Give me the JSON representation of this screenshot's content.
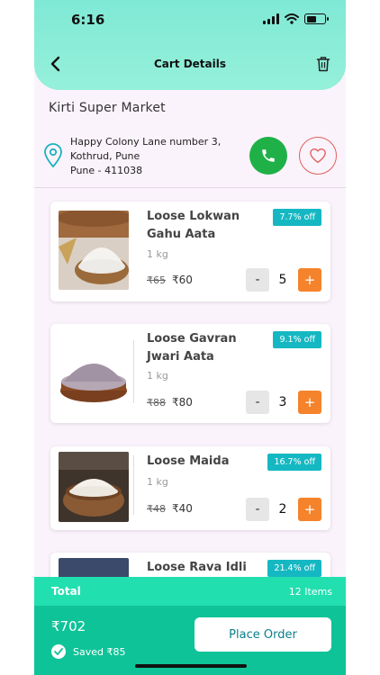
{
  "status_bar": {
    "time": "6:16"
  },
  "header": {
    "title": "Cart Details"
  },
  "store": {
    "name": "Kirti Super Market",
    "address_lines": [
      "Happy Colony Lane number 3,",
      "Kothrud, Pune",
      "Pune - 411038"
    ]
  },
  "cart": {
    "items": [
      {
        "name": "Loose Lokwan Gahu Aata",
        "discount": "7.7% off",
        "weight": "1 kg",
        "old_price": "₹65",
        "price": "₹60",
        "qty": "5"
      },
      {
        "name": "Loose Gavran Jwari Aata",
        "discount": "9.1% off",
        "weight": "1 kg",
        "old_price": "₹88",
        "price": "₹80",
        "qty": "3"
      },
      {
        "name": "Loose Maida",
        "discount": "16.7% off",
        "weight": "1 kg",
        "old_price": "₹48",
        "price": "₹40",
        "qty": "2"
      },
      {
        "name": "Loose Rava Idli",
        "discount": "21.4% off"
      }
    ],
    "minus_label": "-",
    "plus_label": "+"
  },
  "footer": {
    "total_label": "Total",
    "items_count": "12  Items",
    "grand_total": "₹702",
    "saved": "Saved ₹85",
    "place_order": "Place Order"
  },
  "colors": {
    "header": "#8ef0d9",
    "accent_teal": "#15b8c2",
    "call_green": "#1fb148",
    "plus_orange": "#f5832b",
    "footer_green": "#0fc398"
  },
  "icons": [
    "back-arrow-icon",
    "trash-icon",
    "location-pin-icon",
    "phone-icon",
    "heart-icon",
    "check-icon"
  ]
}
